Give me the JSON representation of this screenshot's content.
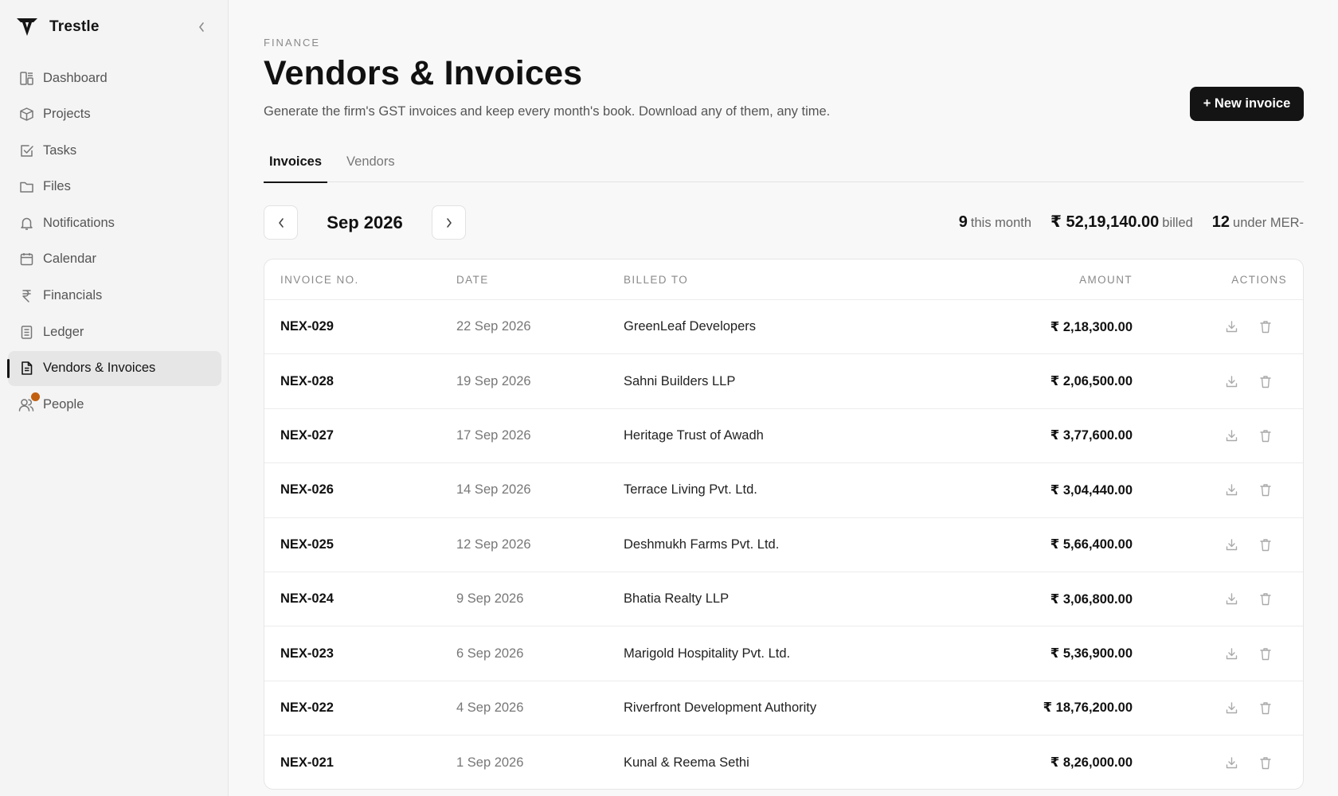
{
  "brand": {
    "name": "Trestle"
  },
  "sidebar": {
    "items": [
      {
        "label": "Dashboard",
        "icon": "dashboard-icon"
      },
      {
        "label": "Projects",
        "icon": "box-icon"
      },
      {
        "label": "Tasks",
        "icon": "checkbox-icon"
      },
      {
        "label": "Files",
        "icon": "folder-icon"
      },
      {
        "label": "Notifications",
        "icon": "bell-icon"
      },
      {
        "label": "Calendar",
        "icon": "calendar-icon"
      },
      {
        "label": "Financials",
        "icon": "rupee-icon"
      },
      {
        "label": "Ledger",
        "icon": "ledger-icon"
      },
      {
        "label": "Vendors & Invoices",
        "icon": "document-icon",
        "active": true
      },
      {
        "label": "People",
        "icon": "people-icon",
        "badge_color": "#c25f0f"
      }
    ]
  },
  "header": {
    "eyebrow": "FINANCE",
    "title": "Vendors & Invoices",
    "subtitle": "Generate the firm's GST invoices and keep every month's book. Download any of them, any time.",
    "new_button": "+ New invoice"
  },
  "tabs": [
    {
      "label": "Invoices",
      "active": true
    },
    {
      "label": "Vendors",
      "active": false
    }
  ],
  "month": {
    "label": "Sep 2026"
  },
  "stats": {
    "count": "9",
    "count_label": "this month",
    "billed": "₹ 52,19,140.00",
    "billed_label": "billed",
    "under": "12",
    "under_label": "under MER-"
  },
  "table": {
    "columns": [
      "INVOICE NO.",
      "DATE",
      "BILLED TO",
      "AMOUNT",
      "ACTIONS"
    ],
    "rows": [
      {
        "invoice": "NEX-029",
        "date": "22 Sep 2026",
        "billed_to": "GreenLeaf Developers",
        "amount": "₹ 2,18,300.00"
      },
      {
        "invoice": "NEX-028",
        "date": "19 Sep 2026",
        "billed_to": "Sahni Builders LLP",
        "amount": "₹ 2,06,500.00"
      },
      {
        "invoice": "NEX-027",
        "date": "17 Sep 2026",
        "billed_to": "Heritage Trust of Awadh",
        "amount": "₹ 3,77,600.00"
      },
      {
        "invoice": "NEX-026",
        "date": "14 Sep 2026",
        "billed_to": "Terrace Living Pvt. Ltd.",
        "amount": "₹ 3,04,440.00"
      },
      {
        "invoice": "NEX-025",
        "date": "12 Sep 2026",
        "billed_to": "Deshmukh Farms Pvt. Ltd.",
        "amount": "₹ 5,66,400.00"
      },
      {
        "invoice": "NEX-024",
        "date": "9 Sep 2026",
        "billed_to": "Bhatia Realty LLP",
        "amount": "₹ 3,06,800.00"
      },
      {
        "invoice": "NEX-023",
        "date": "6 Sep 2026",
        "billed_to": "Marigold Hospitality Pvt. Ltd.",
        "amount": "₹ 5,36,900.00"
      },
      {
        "invoice": "NEX-022",
        "date": "4 Sep 2026",
        "billed_to": "Riverfront Development Authority",
        "amount": "₹ 18,76,200.00"
      },
      {
        "invoice": "NEX-021",
        "date": "1 Sep 2026",
        "billed_to": "Kunal & Reema Sethi",
        "amount": "₹ 8,26,000.00"
      }
    ]
  }
}
